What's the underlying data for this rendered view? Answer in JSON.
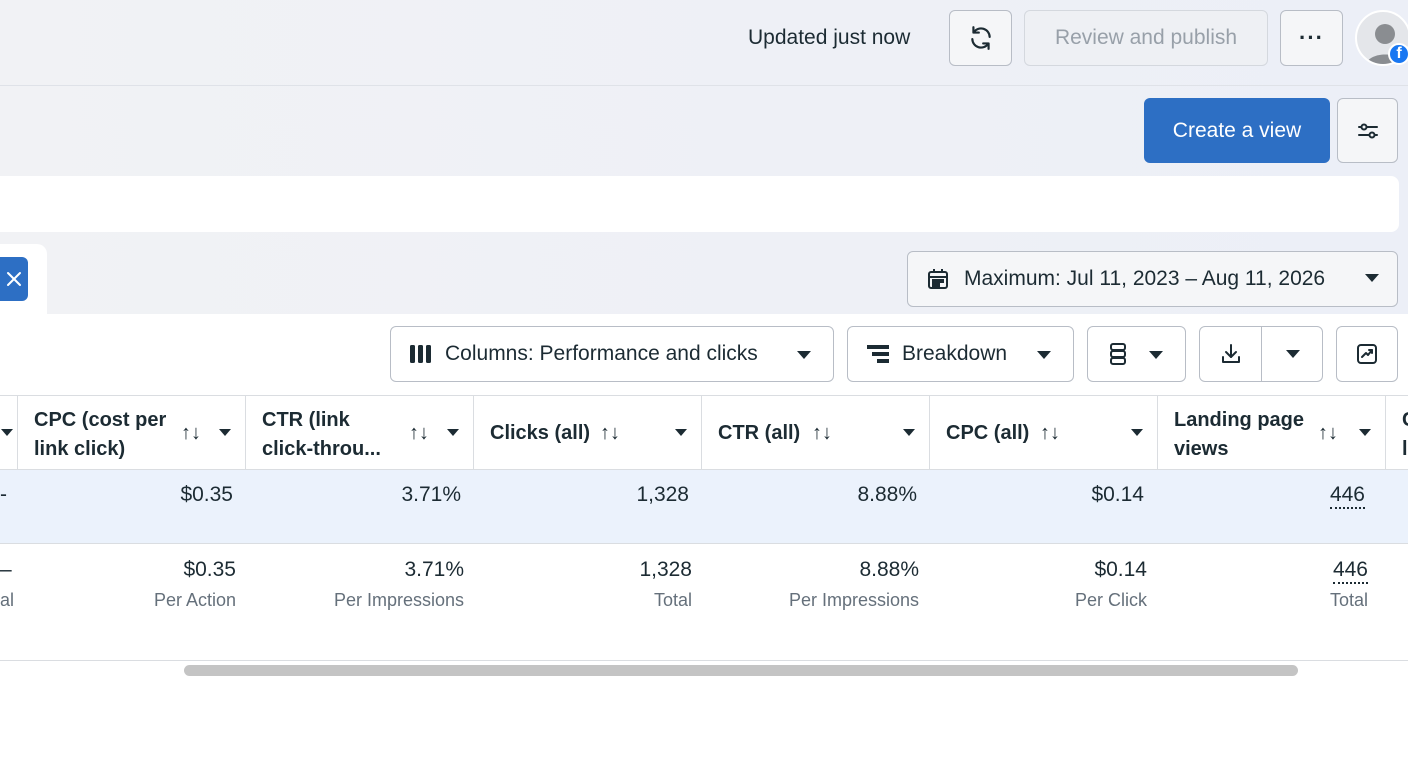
{
  "header": {
    "updated": "Updated just now",
    "review_label": "Review and publish",
    "more_label": "···"
  },
  "actions": {
    "create_view": "Create a view"
  },
  "date_range": {
    "label": "Maximum: Jul 11, 2023 – Aug 11, 2026"
  },
  "toolbar": {
    "columns": "Columns: Performance and clicks",
    "breakdown": "Breakdown"
  },
  "table": {
    "columns": [
      {
        "line1": "CPC (cost per",
        "line2": "link click)"
      },
      {
        "line1": "CTR (link",
        "line2": "click-throu..."
      },
      {
        "line1": "Clicks (all)",
        "line2": ""
      },
      {
        "line1": "CTR (all)",
        "line2": ""
      },
      {
        "line1": "CPC (all)",
        "line2": ""
      },
      {
        "line1": "Landing page",
        "line2": "views"
      },
      {
        "line1": "C",
        "line2": "la"
      }
    ],
    "sort_glyph": "↑↓",
    "row1": {
      "lead": "-",
      "values": [
        "$0.35",
        "3.71%",
        "1,328",
        "8.88%",
        "$0.14",
        "446"
      ]
    },
    "row2": {
      "lead": "–",
      "lead_sub": "al",
      "values": [
        "$0.35",
        "3.71%",
        "1,328",
        "8.88%",
        "$0.14",
        "446"
      ],
      "subs": [
        "Per Action",
        "Per Impressions",
        "Total",
        "Per Impressions",
        "Per Click",
        "Total"
      ]
    }
  },
  "colors": {
    "primary": "#2d6fc4",
    "selected_row": "#ebf2fc",
    "facebook": "#1877f2"
  }
}
